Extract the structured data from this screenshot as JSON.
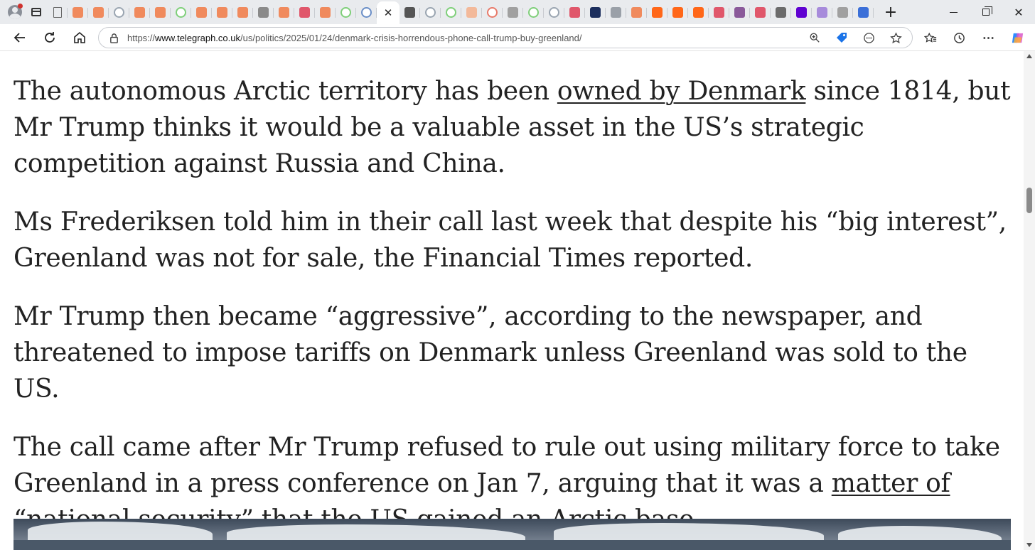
{
  "browser": {
    "tabs": [
      {
        "icon": "document-icon",
        "style": "doc",
        "color": "#666666"
      },
      {
        "icon": "substack-icon",
        "style": "sq",
        "color": "#f08a5d"
      },
      {
        "icon": "substack-icon",
        "style": "sq",
        "color": "#f08a5d"
      },
      {
        "icon": "wiki-globe-icon",
        "style": "ring",
        "color": "#9aa5b1"
      },
      {
        "icon": "substack-icon",
        "style": "sq",
        "color": "#f08a5d"
      },
      {
        "icon": "substack-icon",
        "style": "sq",
        "color": "#f08a5d"
      },
      {
        "icon": "play-icon",
        "style": "ring",
        "color": "#7fcf7a"
      },
      {
        "icon": "substack-icon",
        "style": "sq",
        "color": "#f08a5d"
      },
      {
        "icon": "substack-icon",
        "style": "sq",
        "color": "#f08a5d"
      },
      {
        "icon": "substack-icon",
        "style": "sq",
        "color": "#f08a5d"
      },
      {
        "icon": "news-icon",
        "style": "sq",
        "color": "#8a8a8a"
      },
      {
        "icon": "substack-icon",
        "style": "sq",
        "color": "#f08a5d"
      },
      {
        "icon": "youtube-icon",
        "style": "sq",
        "color": "#e0576b"
      },
      {
        "icon": "substack-icon",
        "style": "sq",
        "color": "#f08a5d"
      },
      {
        "icon": "play-icon",
        "style": "ring",
        "color": "#7fcf7a"
      },
      {
        "icon": "search-icon",
        "style": "ring",
        "color": "#6b8fc7"
      },
      {
        "icon": "close-icon",
        "style": "active",
        "color": "#222222"
      },
      {
        "icon": "diamond-icon",
        "style": "sq",
        "color": "#555555"
      },
      {
        "icon": "wiki-globe-icon",
        "style": "ring",
        "color": "#9aa5b1"
      },
      {
        "icon": "play-icon",
        "style": "ring",
        "color": "#7fcf7a"
      },
      {
        "icon": "substack-icon",
        "style": "sq",
        "color": "#f3b99a"
      },
      {
        "icon": "e-icon",
        "style": "ring",
        "color": "#e87a6a"
      },
      {
        "icon": "bird-icon",
        "style": "sq",
        "color": "#a0a0a0"
      },
      {
        "icon": "play-icon",
        "style": "ring",
        "color": "#7fcf7a"
      },
      {
        "icon": "wiki-globe-icon",
        "style": "ring",
        "color": "#9aa5b1"
      },
      {
        "icon": "youtube-icon",
        "style": "sq",
        "color": "#e0576b"
      },
      {
        "icon": "fox-news-icon",
        "style": "sq",
        "color": "#1c2f5e"
      },
      {
        "icon": "gp-icon",
        "style": "sq",
        "color": "#9aa0a8"
      },
      {
        "icon": "substack-icon",
        "style": "sq",
        "color": "#f08a5d"
      },
      {
        "icon": "substack-icon",
        "style": "sq",
        "color": "#ff6719"
      },
      {
        "icon": "substack-icon",
        "style": "sq",
        "color": "#ff6719"
      },
      {
        "icon": "substack-icon",
        "style": "sq",
        "color": "#ff6719"
      },
      {
        "icon": "youtube-icon",
        "style": "sq",
        "color": "#e0576b"
      },
      {
        "icon": "flag-icon",
        "style": "sq",
        "color": "#8a5a9a"
      },
      {
        "icon": "youtube-icon",
        "style": "sq",
        "color": "#e0576b"
      },
      {
        "icon": "photo-icon",
        "style": "sq",
        "color": "#6b6b6b"
      },
      {
        "icon": "yahoo-icon",
        "style": "sq",
        "color": "#5f01d1"
      },
      {
        "icon": "yahoo-icon",
        "style": "sq",
        "color": "#a78bdb"
      },
      {
        "icon": "bird-icon",
        "style": "sq",
        "color": "#a0a0a0"
      },
      {
        "icon": "search-icon",
        "style": "sq",
        "color": "#3b6fd8"
      }
    ],
    "new_tab_label": "+",
    "url_prefix": "https://",
    "url_host": "www.telegraph.co.uk",
    "url_path": "/us/politics/2025/01/24/denmark-crisis-horrendous-phone-call-trump-buy-greenland/",
    "accent_color": "#1a73e8"
  },
  "article": {
    "p1_before": "The autonomous Arctic territory has been ",
    "p1_link": "owned by Denmark",
    "p1_after": " since 1814, but Mr Trump thinks it would be a valuable asset in the US’s strategic competition against Russia and China.",
    "p2": "Ms Frederiksen told him in their call last week that despite his “big interest”, Greenland was not for sale, the Financial Times reported.",
    "p3": "Mr Trump then became “aggressive”, according to the newspaper, and threatened to impose tariffs on Denmark unless Greenland was sold to the US.",
    "p4_before": "The call came after Mr Trump refused to rule out using military force to take Greenland in a press conference on Jan 7, arguing that it was a ",
    "p4_link": "matter of “national security”",
    "p4_after": " that the US gained an Arctic base."
  },
  "scroll": {
    "position_fraction": 0.28
  }
}
